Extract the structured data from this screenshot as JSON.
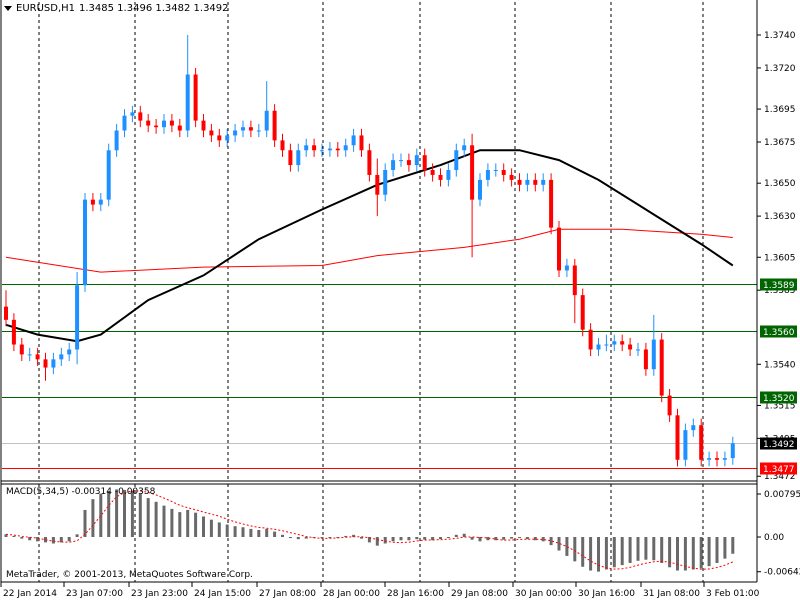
{
  "header": {
    "symbol": "EURUSD,H1",
    "ohlc": "1.3485 1.3496 1.3482 1.3492"
  },
  "macd_panel": {
    "name": "MACD(5,34,5)",
    "value1": "-0.00314",
    "value2": "-0.00358"
  },
  "copyright": "MetaTrader, © 2001-2013, MetaQuotes Software Corp.",
  "colors": {
    "bull": "#1e90ff",
    "bear": "#ff0000",
    "level": "#006400",
    "bid": "#c0c0c0",
    "ask": "#ff0000",
    "ma_fast": "#000000",
    "ma_slow": "#ff0000",
    "macd_hist": "#696969",
    "signal": "#ff0000"
  },
  "chart_data": {
    "type": "candlestick",
    "title": "EURUSD,H1",
    "ylim": [
      1.3466,
      1.3752
    ],
    "price_ticks": [
      "1.3740",
      "1.3720",
      "1.3695",
      "1.3675",
      "1.3650",
      "1.3630",
      "1.3605",
      "1.3585",
      "1.3540",
      "1.3515",
      "1.3495",
      "1.3472"
    ],
    "time_labels": [
      "22 Jan 2014",
      "23 Jan 07:00",
      "23 Jan 23:00",
      "24 Jan 15:00",
      "27 Jan 08:00",
      "28 Jan 00:00",
      "28 Jan 16:00",
      "29 Jan 08:00",
      "30 Jan 00:00",
      "30 Jan 16:00",
      "31 Jan 08:00",
      "3 Feb 01:00"
    ],
    "closes": [
      1.3567,
      1.3552,
      1.3546,
      1.3546,
      1.3543,
      1.3538,
      1.3543,
      1.3546,
      1.3549,
      1.3588,
      1.364,
      1.3637,
      1.364,
      1.367,
      1.3682,
      1.3691,
      1.3693,
      1.3688,
      1.3685,
      1.3684,
      1.3688,
      1.3685,
      1.3682,
      1.3716,
      1.3688,
      1.3682,
      1.3679,
      1.3676,
      1.3679,
      1.3682,
      1.3684,
      1.3682,
      1.3682,
      1.3694,
      1.3676,
      1.367,
      1.3661,
      1.367,
      1.3673,
      1.367,
      1.367,
      1.3671,
      1.367,
      1.3673,
      1.3679,
      1.367,
      1.3655,
      1.3643,
      1.3658,
      1.3664,
      1.3664,
      1.3661,
      1.3667,
      1.3658,
      1.3655,
      1.3652,
      1.3658,
      1.367,
      1.3673,
      1.364,
      1.3652,
      1.3658,
      1.3658,
      1.3655,
      1.3652,
      1.3649,
      1.3652,
      1.3649,
      1.3652,
      1.3623,
      1.3597,
      1.36,
      1.3582,
      1.3561,
      1.3549,
      1.3552,
      1.3552,
      1.3554,
      1.3552,
      1.3549,
      1.3549,
      1.3537,
      1.3555,
      1.3521,
      1.3509,
      1.3482,
      1.35,
      1.3503,
      1.3482,
      1.3483,
      1.3482,
      1.3483,
      1.3492
    ],
    "first_open": 1.3575,
    "high_overrides": {
      "0": 1.3585,
      "9": 1.3596,
      "23": 1.374,
      "33": 1.3712,
      "47": 1.3665,
      "59": 1.368,
      "82": 1.357,
      "76": 1.3558
    },
    "low_overrides": {
      "5": 1.353,
      "9": 1.354,
      "59": 1.3605,
      "47": 1.363,
      "72": 1.3565,
      "86": 1.3478,
      "88": 1.3478
    },
    "levels": [
      {
        "price": 1.3589,
        "label": "1.3589",
        "kind": "level"
      },
      {
        "price": 1.356,
        "label": "1.3560",
        "kind": "level"
      },
      {
        "price": 1.352,
        "label": "1.3520",
        "kind": "level"
      },
      {
        "price": 1.3492,
        "label": "1.3492",
        "kind": "bid"
      },
      {
        "price": 1.3477,
        "label": "1.3477",
        "kind": "ask"
      }
    ],
    "ma_fast": [
      [
        0,
        1.3564
      ],
      [
        4,
        1.3558
      ],
      [
        9,
        1.3554
      ],
      [
        12,
        1.3558
      ],
      [
        18,
        1.3579
      ],
      [
        25,
        1.3594
      ],
      [
        32,
        1.3616
      ],
      [
        40,
        1.3634
      ],
      [
        47,
        1.3649
      ],
      [
        55,
        1.3661
      ],
      [
        60,
        1.367
      ],
      [
        65,
        1.367
      ],
      [
        70,
        1.3664
      ],
      [
        75,
        1.3652
      ],
      [
        82,
        1.3631
      ],
      [
        88,
        1.3613
      ],
      [
        92,
        1.36
      ]
    ],
    "ma_slow": [
      [
        0,
        1.3605
      ],
      [
        4,
        1.3602
      ],
      [
        12,
        1.3596
      ],
      [
        25,
        1.3599
      ],
      [
        40,
        1.36
      ],
      [
        47,
        1.3606
      ],
      [
        58,
        1.3611
      ],
      [
        65,
        1.3616
      ],
      [
        70,
        1.3622
      ],
      [
        78,
        1.3622
      ],
      [
        88,
        1.3619
      ],
      [
        92,
        1.3617
      ]
    ],
    "macd": {
      "ticks": [
        "0.00795",
        "0.00",
        "-0.00642"
      ],
      "tick_values": [
        0.00795,
        0,
        -0.00642
      ],
      "hist": [
        0.0005,
        0.0002,
        -0.0003,
        -0.0006,
        -0.0008,
        -0.001,
        -0.0012,
        -0.001,
        -0.0008,
        0.0005,
        0.005,
        0.007,
        0.008,
        0.0085,
        0.0088,
        0.0087,
        0.0085,
        0.008,
        0.0072,
        0.0065,
        0.0058,
        0.0052,
        0.0046,
        0.005,
        0.0045,
        0.0038,
        0.0032,
        0.0027,
        0.0023,
        0.002,
        0.0018,
        0.0015,
        0.0013,
        0.0015,
        0.001,
        0.0004,
        -0.0002,
        -0.0004,
        -0.0003,
        -0.0002,
        -0.0002,
        -0.0001,
        0.0,
        0.0002,
        0.0004,
        -0.0003,
        -0.001,
        -0.0016,
        -0.0012,
        -0.0008,
        -0.0006,
        -0.0006,
        -0.0004,
        -0.0005,
        -0.0006,
        -0.0004,
        -0.0001,
        0.0004,
        0.0006,
        -0.0005,
        -0.0008,
        -0.0006,
        -0.0006,
        -0.0005,
        -0.0003,
        -0.0002,
        -0.0004,
        -0.0006,
        -0.0008,
        -0.0015,
        -0.0025,
        -0.0035,
        -0.0045,
        -0.0055,
        -0.0062,
        -0.0064,
        -0.006,
        -0.0056,
        -0.0052,
        -0.0048,
        -0.0044,
        -0.0042,
        -0.0043,
        -0.0048,
        -0.0056,
        -0.0062,
        -0.0062,
        -0.006,
        -0.0058,
        -0.0054,
        -0.0048,
        -0.004,
        -0.0031
      ]
    }
  }
}
